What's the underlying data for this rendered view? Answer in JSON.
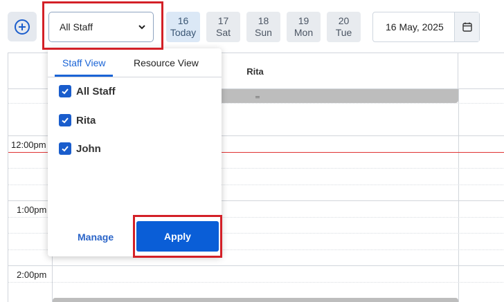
{
  "toolbar": {
    "staff_select_value": "All Staff",
    "days": [
      {
        "num": "16",
        "label": "Today"
      },
      {
        "num": "17",
        "label": "Sat"
      },
      {
        "num": "18",
        "label": "Sun"
      },
      {
        "num": "19",
        "label": "Mon"
      },
      {
        "num": "20",
        "label": "Tue"
      }
    ],
    "date_value": "16 May, 2025"
  },
  "calendar": {
    "column_header": "Rita",
    "times": [
      "12:00pm",
      "1:00pm",
      "2:00pm"
    ]
  },
  "staff_panel": {
    "tabs": [
      "Staff View",
      "Resource View"
    ],
    "options": [
      "All Staff",
      "Rita",
      "John"
    ],
    "manage_label": "Manage",
    "apply_label": "Apply"
  },
  "colors": {
    "accent": "#0a5ed7",
    "current_time_line": "#e03131",
    "highlight": "#d32027"
  }
}
